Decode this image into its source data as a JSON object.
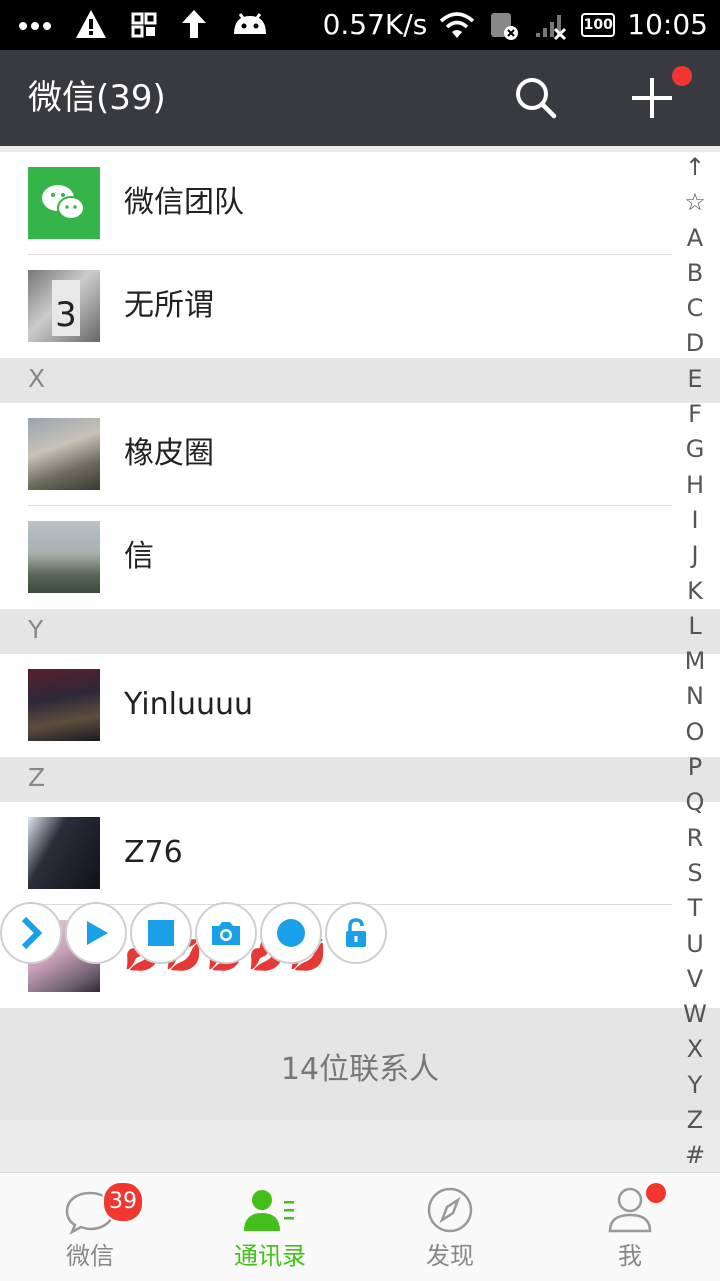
{
  "status_bar": {
    "icons_left": [
      "more-dots-icon",
      "warning-icon",
      "grid-icon",
      "upload-arrow-icon",
      "android-icon"
    ],
    "network_speed": "0.57K/s",
    "battery": "100",
    "time": "10:05"
  },
  "header": {
    "title": "微信(39)",
    "search_icon": "search-icon",
    "add_icon": "plus-icon",
    "accent_dot_color": "#f43530"
  },
  "contacts": {
    "rows": [
      {
        "name": "微信团队",
        "avatar": "wechat-logo"
      },
      {
        "name": "无所谓",
        "avatar": "photo-number-3"
      },
      {
        "section": "X"
      },
      {
        "name": "橡皮圈",
        "avatar": "photo-person-bench"
      },
      {
        "name": "信",
        "avatar": "photo-mountains"
      },
      {
        "section": "Y"
      },
      {
        "name": "Yinluuuu",
        "avatar": "photo-stage"
      },
      {
        "section": "Z"
      },
      {
        "name": "Z76",
        "avatar": "photo-dark"
      },
      {
        "name": "💋💋💋💋💋",
        "avatar": "photo-girl"
      }
    ],
    "footer": "14位联系人"
  },
  "index_bar": [
    "↑",
    "☆",
    "A",
    "B",
    "C",
    "D",
    "E",
    "F",
    "G",
    "H",
    "I",
    "J",
    "K",
    "L",
    "M",
    "N",
    "O",
    "P",
    "Q",
    "R",
    "S",
    "T",
    "U",
    "V",
    "W",
    "X",
    "Y",
    "Z",
    "#"
  ],
  "float_toolbar": [
    "collapse-chevron-icon",
    "play-icon",
    "stop-icon",
    "camera-icon",
    "record-icon",
    "unlock-icon"
  ],
  "tabs": [
    {
      "label": "微信",
      "badge": "39"
    },
    {
      "label": "通讯录"
    },
    {
      "label": "发现"
    },
    {
      "label": "我"
    }
  ],
  "colors": {
    "title_bar": "#393a3f",
    "active_green": "#45c01a",
    "badge_red": "#f43530",
    "toolbar_blue": "#1aa0e8"
  }
}
